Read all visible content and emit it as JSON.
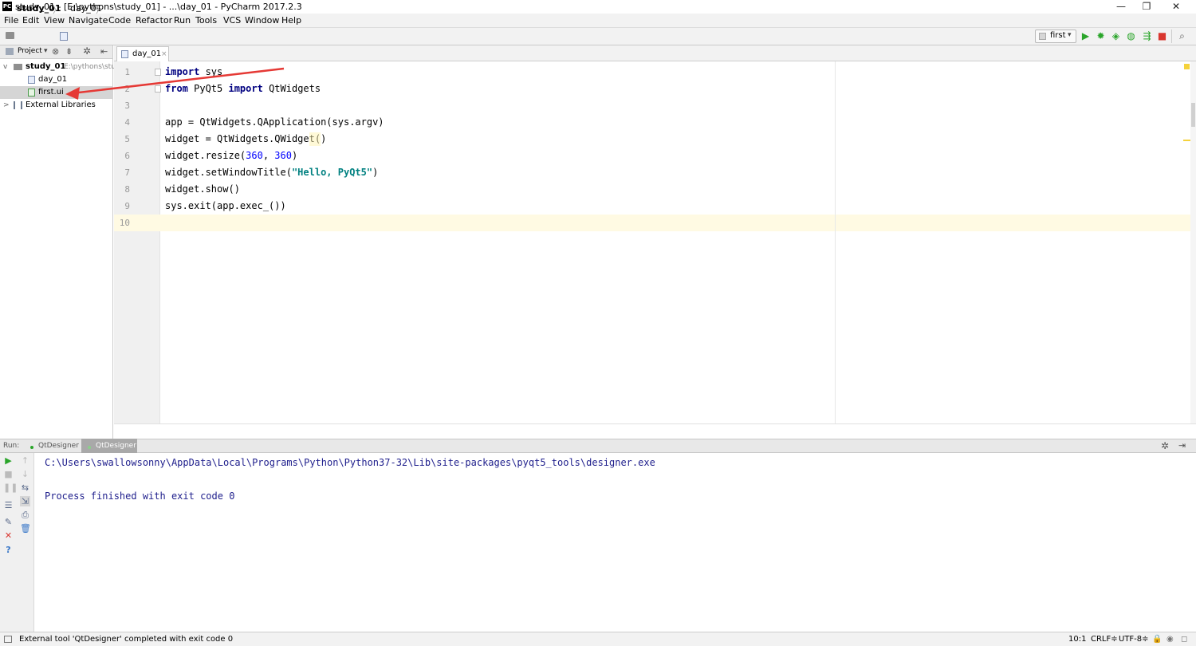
{
  "window": {
    "title": "study_01 - [E:\\pythons\\study_01] - ...\\day_01 - PyCharm 2017.2.3",
    "app_icon": "PC",
    "minimize": "—",
    "restore": "❐",
    "close": "✕"
  },
  "menu": [
    "File",
    "Edit",
    "View",
    "Navigate",
    "Code",
    "Refactor",
    "Run",
    "Tools",
    "VCS",
    "Window",
    "Help"
  ],
  "breadcrumb": {
    "project": "study_01",
    "file": "day_01"
  },
  "toolbar": {
    "run_config": "first"
  },
  "project_panel": {
    "label": "Project",
    "root": {
      "name": "study_01",
      "path": "E:\\pythons\\stu"
    },
    "items": [
      {
        "name": "day_01"
      },
      {
        "name": "first.ui"
      }
    ],
    "libs": "External Libraries"
  },
  "editor": {
    "tab": "day_01",
    "line_numbers": [
      "1",
      "2",
      "3",
      "4",
      "5",
      "6",
      "7",
      "8",
      "9",
      "10"
    ]
  },
  "code": {
    "l1_kw": "import",
    "l1_rest": " sys",
    "l2_kw1": "from",
    "l2_mid": " PyQt5 ",
    "l2_kw2": "import",
    "l2_rest": " QtWidgets",
    "l4": "app = QtWidgets.QApplication(sys.argv)",
    "l5": "widget = QtWidgets.QWidget()",
    "l6_a": "widget.resize(",
    "l6_n1": "360",
    "l6_b": ", ",
    "l6_n2": "360",
    "l6_c": ")",
    "l7_a": "widget.setWindowTitle(",
    "l7_s": "\"Hello, PyQt5\"",
    "l7_c": ")",
    "l8": "widget.show()",
    "l9": "sys.exit(app.exec_())"
  },
  "run_panel": {
    "label": "Run:",
    "tabs": [
      "QtDesigner",
      "QtDesigner"
    ],
    "console": [
      "C:\\Users\\swallowsonny\\AppData\\Local\\Programs\\Python\\Python37-32\\Lib\\site-packages\\pyqt5_tools\\designer.exe",
      "Process finished with exit code 0"
    ]
  },
  "status": {
    "message": "External tool 'QtDesigner' completed with exit code 0",
    "position": "10:1",
    "line_sep": "CRLF≑",
    "encoding": "UTF-8≑"
  },
  "colors": {
    "annotation_arrow": "#e53935",
    "run_green": "#2aa52a",
    "stop_red": "#d9362f"
  }
}
